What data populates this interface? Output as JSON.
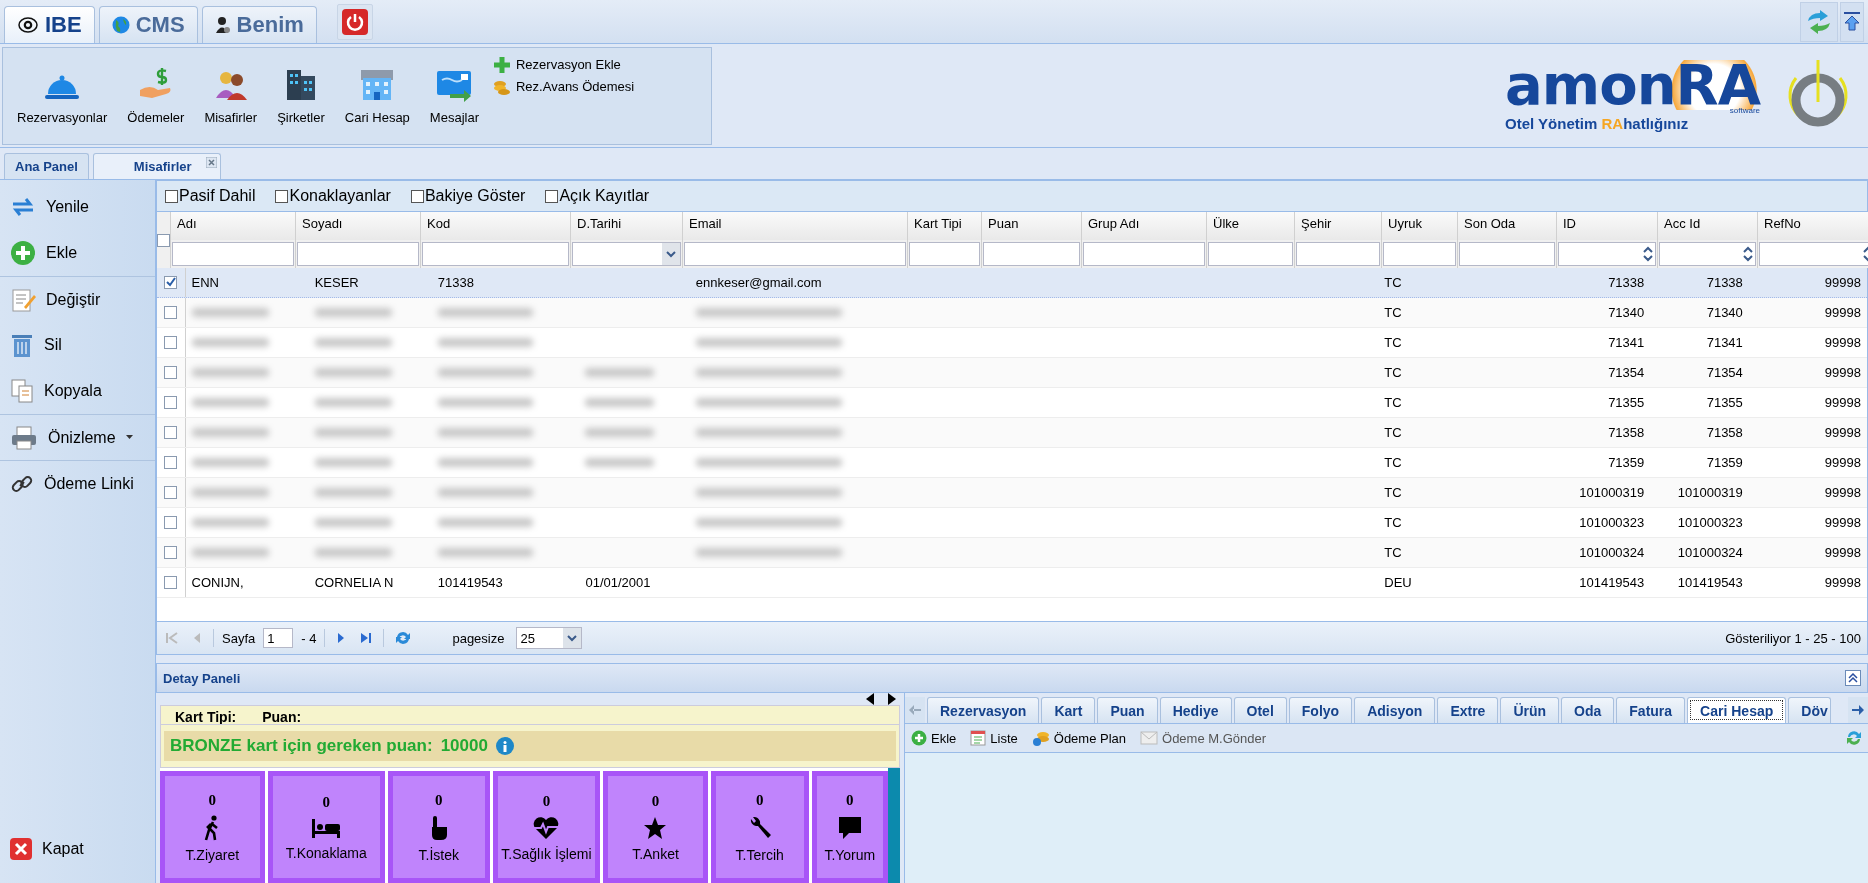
{
  "top_tabs": [
    {
      "label": "IBE",
      "selected": true
    },
    {
      "label": "CMS",
      "selected": false
    },
    {
      "label": "Benim",
      "selected": false
    }
  ],
  "ribbon": {
    "buttons": [
      "Rezervasyonlar",
      "Ödemeler",
      "Misafirler",
      "Şirketler",
      "Cari Hesap",
      "Mesajlar"
    ],
    "links": [
      "Rezervasyon Ekle",
      "Rez.Avans Ödemesi"
    ]
  },
  "logo": {
    "wordmark": [
      "amon",
      "RA"
    ],
    "subtitle": "software",
    "tagline": [
      "Otel Yönetim ",
      "RA",
      "hatlığınız"
    ]
  },
  "page_tabs": [
    {
      "label": "Ana Panel",
      "selected": false,
      "closable": false
    },
    {
      "label": "Misafirler",
      "selected": true,
      "closable": true
    }
  ],
  "sidebar": {
    "items": [
      {
        "label": "Yenile",
        "dropdown": false
      },
      {
        "label": "Ekle",
        "dropdown": false
      },
      {
        "label": "Değiştir",
        "dropdown": false
      },
      {
        "label": "Sil",
        "dropdown": false
      },
      {
        "label": "Kopyala",
        "dropdown": false
      },
      {
        "label": "Önizleme",
        "dropdown": true
      },
      {
        "label": "Ödeme Linki",
        "dropdown": false
      }
    ],
    "close": "Kapat"
  },
  "filters": [
    {
      "label": "Pasif Dahil",
      "checked": false
    },
    {
      "label": "Konaklayanlar",
      "checked": false
    },
    {
      "label": "Bakiye Göster",
      "checked": false
    },
    {
      "label": "Açık Kayıtlar",
      "checked": false
    }
  ],
  "table": {
    "header_checked": false,
    "columns": [
      {
        "label": "Adı",
        "kind": "text"
      },
      {
        "label": "Soyadı",
        "kind": "text"
      },
      {
        "label": "Kod",
        "kind": "text"
      },
      {
        "label": "D.Tarihi",
        "kind": "date"
      },
      {
        "label": "Email",
        "kind": "text"
      },
      {
        "label": "Kart Tipi",
        "kind": "text"
      },
      {
        "label": "Puan",
        "kind": "text"
      },
      {
        "label": "Grup Adı",
        "kind": "text"
      },
      {
        "label": "Ülke",
        "kind": "text"
      },
      {
        "label": "Şehir",
        "kind": "text"
      },
      {
        "label": "Uyruk",
        "kind": "text"
      },
      {
        "label": "Son Oda",
        "kind": "text"
      },
      {
        "label": "ID",
        "kind": "number"
      },
      {
        "label": "Acc Id",
        "kind": "number"
      },
      {
        "label": "RefNo",
        "kind": "number"
      }
    ],
    "rows": [
      {
        "selected": true,
        "checked": true,
        "cells": [
          "ENN",
          "KESER",
          "71338",
          null,
          "ennkeser@gmail.com",
          null,
          null,
          null,
          null,
          null,
          "TC",
          null,
          "71338",
          "71338",
          "99998"
        ]
      },
      {
        "selected": false,
        "checked": false,
        "cells": [
          {
            "blurred": true
          },
          {
            "blurred": true
          },
          {
            "blurred": true
          },
          null,
          {
            "blurred": true
          },
          null,
          null,
          null,
          null,
          null,
          "TC",
          null,
          "71340",
          "71340",
          "99998"
        ]
      },
      {
        "selected": false,
        "checked": false,
        "cells": [
          {
            "blurred": true
          },
          {
            "blurred": true
          },
          {
            "blurred": true
          },
          null,
          {
            "blurred": true
          },
          null,
          null,
          null,
          null,
          null,
          "TC",
          null,
          "71341",
          "71341",
          "99998"
        ]
      },
      {
        "selected": false,
        "checked": false,
        "cells": [
          {
            "blurred": true
          },
          {
            "blurred": true
          },
          {
            "blurred": true
          },
          {
            "blurred": true
          },
          {
            "blurred": true
          },
          null,
          null,
          null,
          null,
          null,
          "TC",
          null,
          "71354",
          "71354",
          "99998"
        ]
      },
      {
        "selected": false,
        "checked": false,
        "cells": [
          {
            "blurred": true
          },
          {
            "blurred": true
          },
          {
            "blurred": true
          },
          {
            "blurred": true
          },
          {
            "blurred": true
          },
          null,
          null,
          null,
          null,
          null,
          "TC",
          null,
          "71355",
          "71355",
          "99998"
        ]
      },
      {
        "selected": false,
        "checked": false,
        "cells": [
          {
            "blurred": true
          },
          {
            "blurred": true
          },
          {
            "blurred": true
          },
          {
            "blurred": true
          },
          {
            "blurred": true
          },
          null,
          null,
          null,
          null,
          null,
          "TC",
          null,
          "71358",
          "71358",
          "99998"
        ]
      },
      {
        "selected": false,
        "checked": false,
        "cells": [
          {
            "blurred": true
          },
          {
            "blurred": true
          },
          {
            "blurred": true
          },
          {
            "blurred": true
          },
          {
            "blurred": true
          },
          null,
          null,
          null,
          null,
          null,
          "TC",
          null,
          "71359",
          "71359",
          "99998"
        ]
      },
      {
        "selected": false,
        "checked": false,
        "cells": [
          {
            "blurred": true
          },
          {
            "blurred": true
          },
          {
            "blurred": true
          },
          null,
          {
            "blurred": true
          },
          null,
          null,
          null,
          null,
          null,
          "TC",
          null,
          "101000319",
          "101000319",
          "99998"
        ]
      },
      {
        "selected": false,
        "checked": false,
        "cells": [
          {
            "blurred": true
          },
          {
            "blurred": true
          },
          {
            "blurred": true
          },
          null,
          {
            "blurred": true
          },
          null,
          null,
          null,
          null,
          null,
          "TC",
          null,
          "101000323",
          "101000323",
          "99998"
        ]
      },
      {
        "selected": false,
        "checked": false,
        "cells": [
          {
            "blurred": true
          },
          {
            "blurred": true
          },
          {
            "blurred": true
          },
          null,
          {
            "blurred": true
          },
          null,
          null,
          null,
          null,
          null,
          "TC",
          null,
          "101000324",
          "101000324",
          "99998"
        ]
      },
      {
        "selected": false,
        "checked": false,
        "cells": [
          "CONIJN,",
          "CORNELIA N",
          "101419543",
          "01/01/2001",
          null,
          null,
          null,
          null,
          null,
          null,
          "DEU",
          null,
          "101419543",
          "101419543",
          "99998"
        ]
      }
    ]
  },
  "pager": {
    "page_label": "Sayfa",
    "page": "1",
    "page_total": "- 4",
    "pagesize_label": "pagesize",
    "pagesize": "25",
    "summary": "Gösteriliyor 1 - 25 - 100"
  },
  "detail": {
    "title": "Detay Paneli",
    "card_fields": [
      "Kart Tipi:",
      "Puan:"
    ],
    "requirement_label": "BRONZE kart için gereken puan:",
    "requirement_value": "10000",
    "tiles": [
      {
        "count": "0",
        "label": "T.Ziyaret"
      },
      {
        "count": "0",
        "label": "T.Konaklama"
      },
      {
        "count": "0",
        "label": "T.İstek"
      },
      {
        "count": "0",
        "label": "T.Sağlık İşlemi"
      },
      {
        "count": "0",
        "label": "T.Anket"
      },
      {
        "count": "0",
        "label": "T.Tercih"
      },
      {
        "count": "0",
        "label": "T.Yorum"
      }
    ],
    "tabs": [
      {
        "label": "Rezervasyon",
        "selected": false
      },
      {
        "label": "Kart",
        "selected": false
      },
      {
        "label": "Puan",
        "selected": false
      },
      {
        "label": "Hediye",
        "selected": false
      },
      {
        "label": "Otel",
        "selected": false
      },
      {
        "label": "Folyo",
        "selected": false
      },
      {
        "label": "Adisyon",
        "selected": false
      },
      {
        "label": "Extre",
        "selected": false
      },
      {
        "label": "Ürün",
        "selected": false
      },
      {
        "label": "Oda",
        "selected": false
      },
      {
        "label": "Fatura",
        "selected": false
      },
      {
        "label": "Cari Hesap",
        "selected": true
      },
      {
        "label": "Döv",
        "selected": false
      }
    ],
    "toolbar": [
      {
        "label": "Ekle",
        "disabled": false
      },
      {
        "label": "Liste",
        "disabled": false
      },
      {
        "label": "Ödeme Plan",
        "disabled": false
      },
      {
        "label": "Ödeme M.Gönder",
        "disabled": true
      }
    ]
  }
}
